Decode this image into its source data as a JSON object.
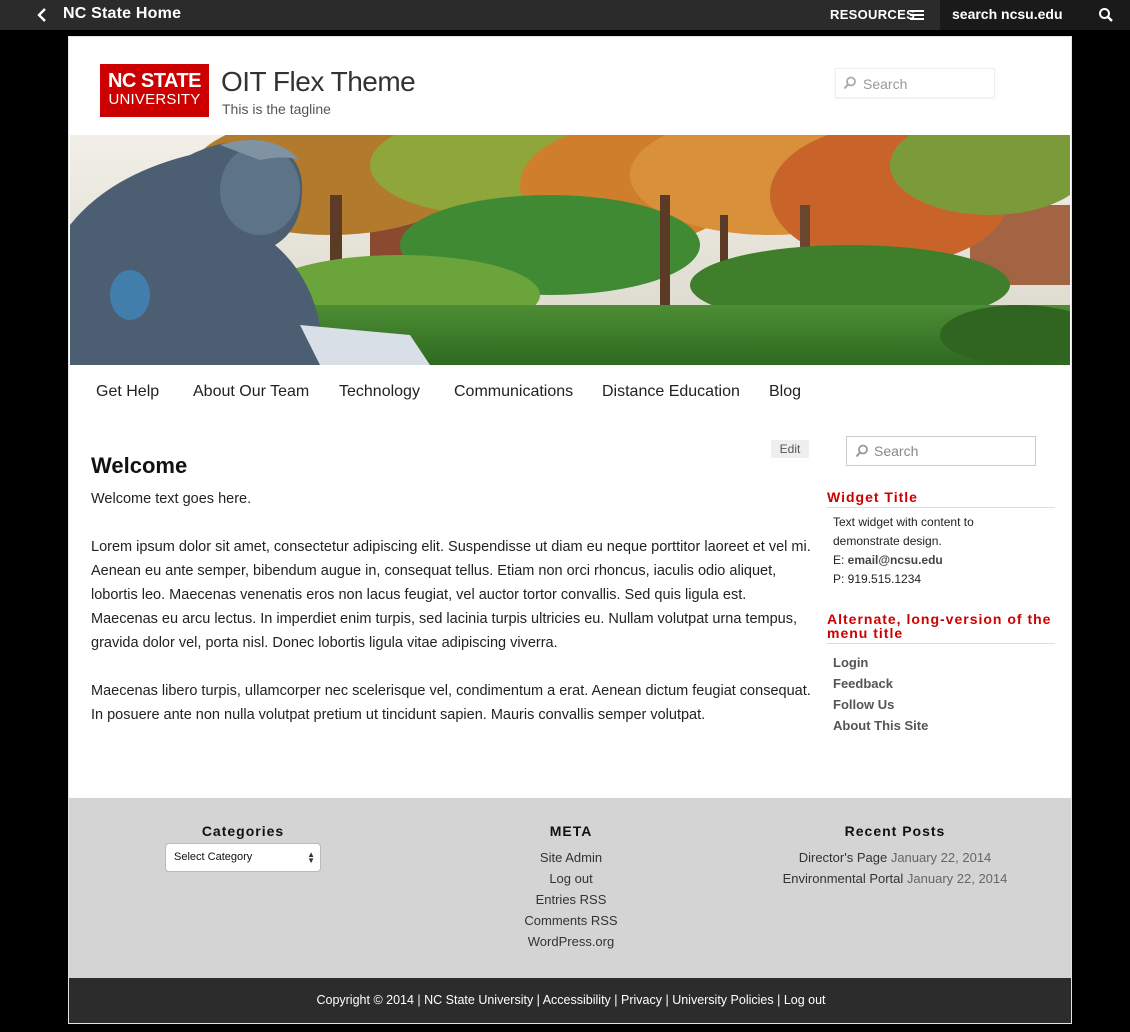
{
  "topbar": {
    "home_label": "NC State Home",
    "resources_label": "RESOURCES",
    "search_value": "search ncsu.edu"
  },
  "header": {
    "logo_line1": "NC STATE",
    "logo_line2": "UNIVERSITY",
    "title": "OIT Flex Theme",
    "tagline": "This is the tagline",
    "search_placeholder": "Search"
  },
  "nav": {
    "items": [
      {
        "label": "Get Help"
      },
      {
        "label": "About Our Team"
      },
      {
        "label": "Technology"
      },
      {
        "label": "Communications"
      },
      {
        "label": "Distance Education"
      },
      {
        "label": "Blog"
      }
    ]
  },
  "main": {
    "edit_label": "Edit",
    "title": "Welcome",
    "paragraphs": [
      "Welcome text goes here.",
      "Lorem ipsum dolor sit amet, consectetur adipiscing elit. Suspendisse ut diam eu neque porttitor laoreet et vel mi. Aenean eu ante semper, bibendum augue in, consequat tellus. Etiam non orci rhoncus, iaculis odio aliquet, lobortis leo. Maecenas venenatis eros non lacus feugiat, vel auctor tortor convallis. Sed quis ligula est. Maecenas eu arcu lectus. In imperdiet enim turpis, sed lacinia turpis ultricies eu. Nullam volutpat urna tempus, gravida dolor vel, porta nisl. Donec lobortis ligula vitae adipiscing viverra.",
      "Maecenas libero turpis, ullamcorper nec scelerisque vel, condimentum a erat. Aenean dictum feugiat consequat. In posuere ante non nulla volutpat pretium ut tincidunt sapien. Mauris convallis semper volutpat."
    ]
  },
  "sidebar": {
    "search_placeholder": "Search",
    "widget_title": "Widget Title",
    "widget_text": "Text widget with content to demonstrate design.",
    "email_prefix": "E: ",
    "email": "email@ncsu.edu",
    "phone": "P: 919.515.1234",
    "menu_title": "Alternate, long-version of the menu title",
    "links": [
      "Login",
      "Feedback",
      "Follow Us",
      "About This Site"
    ]
  },
  "footer": {
    "categories_title": "Categories",
    "select_value": "Select Category",
    "meta_title": "META",
    "meta_links": [
      "Site Admin",
      "Log out",
      "Entries RSS",
      "Comments RSS",
      "WordPress.org"
    ],
    "recent_title": "Recent Posts",
    "recent_posts": [
      {
        "title": "Director's Page",
        "date": "January 22, 2014"
      },
      {
        "title": "Environmental Portal",
        "date": "January 22, 2014"
      }
    ]
  },
  "copyright": {
    "text": "Copyright © 2014",
    "links": [
      "NC State University",
      "Accessibility",
      "Privacy",
      "University Policies",
      "Log out"
    ]
  },
  "colors": {
    "brand_red": "#cc0000",
    "topbar": "#2b2b2b",
    "footer_gray": "#d4d4d4",
    "copybar": "#2c2c2c"
  }
}
